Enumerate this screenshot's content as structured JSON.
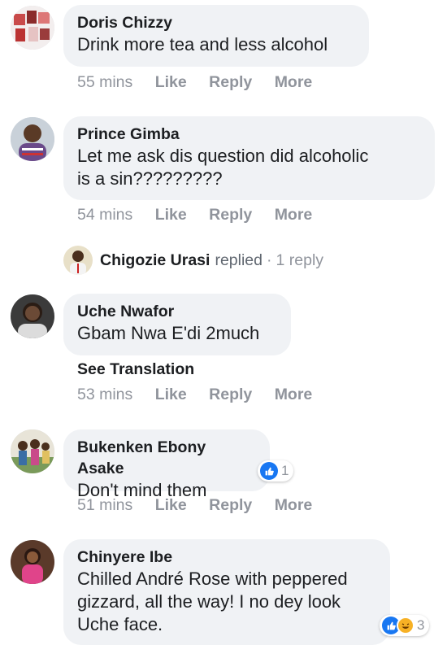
{
  "comments": [
    {
      "name": "Doris Chizzy",
      "text": "Drink more tea and less alcohol",
      "time": "55 mins",
      "like": "Like",
      "reply": "Reply",
      "more": "More"
    },
    {
      "name": "Prince Gimba",
      "text": "Let me ask dis question did alcoholic\nis a sin?????????",
      "time": "54 mins",
      "like": "Like",
      "reply": "Reply",
      "more": "More"
    },
    {
      "name": "Uche Nwafor",
      "text": "Gbam Nwa E'di 2much",
      "see_translation": "See Translation",
      "time": "53 mins",
      "like": "Like",
      "reply": "Reply",
      "more": "More"
    },
    {
      "name": "Bukenken Ebony Asake",
      "text": "Don't mind them",
      "reactions": "1",
      "time": "51 mins",
      "like": "Like",
      "reply": "Reply",
      "more": "More"
    },
    {
      "name": "Chinyere Ibe",
      "text": "Chilled André Rose with peppered\ngizzard, all the way! I no dey look\nUche face.",
      "reactions": "3"
    }
  ],
  "reply_thread": {
    "name": "Chigozie Urasi",
    "verb": "replied",
    "separator": "·",
    "count": "1 reply"
  },
  "colors": {
    "bubble": "#f0f2f5",
    "meta": "#90949c",
    "like_blue": "#1877f2",
    "haha_yellow": "#f7b125"
  },
  "icons": {
    "like": "thumbs-up-icon",
    "haha": "laughing-face-icon"
  }
}
